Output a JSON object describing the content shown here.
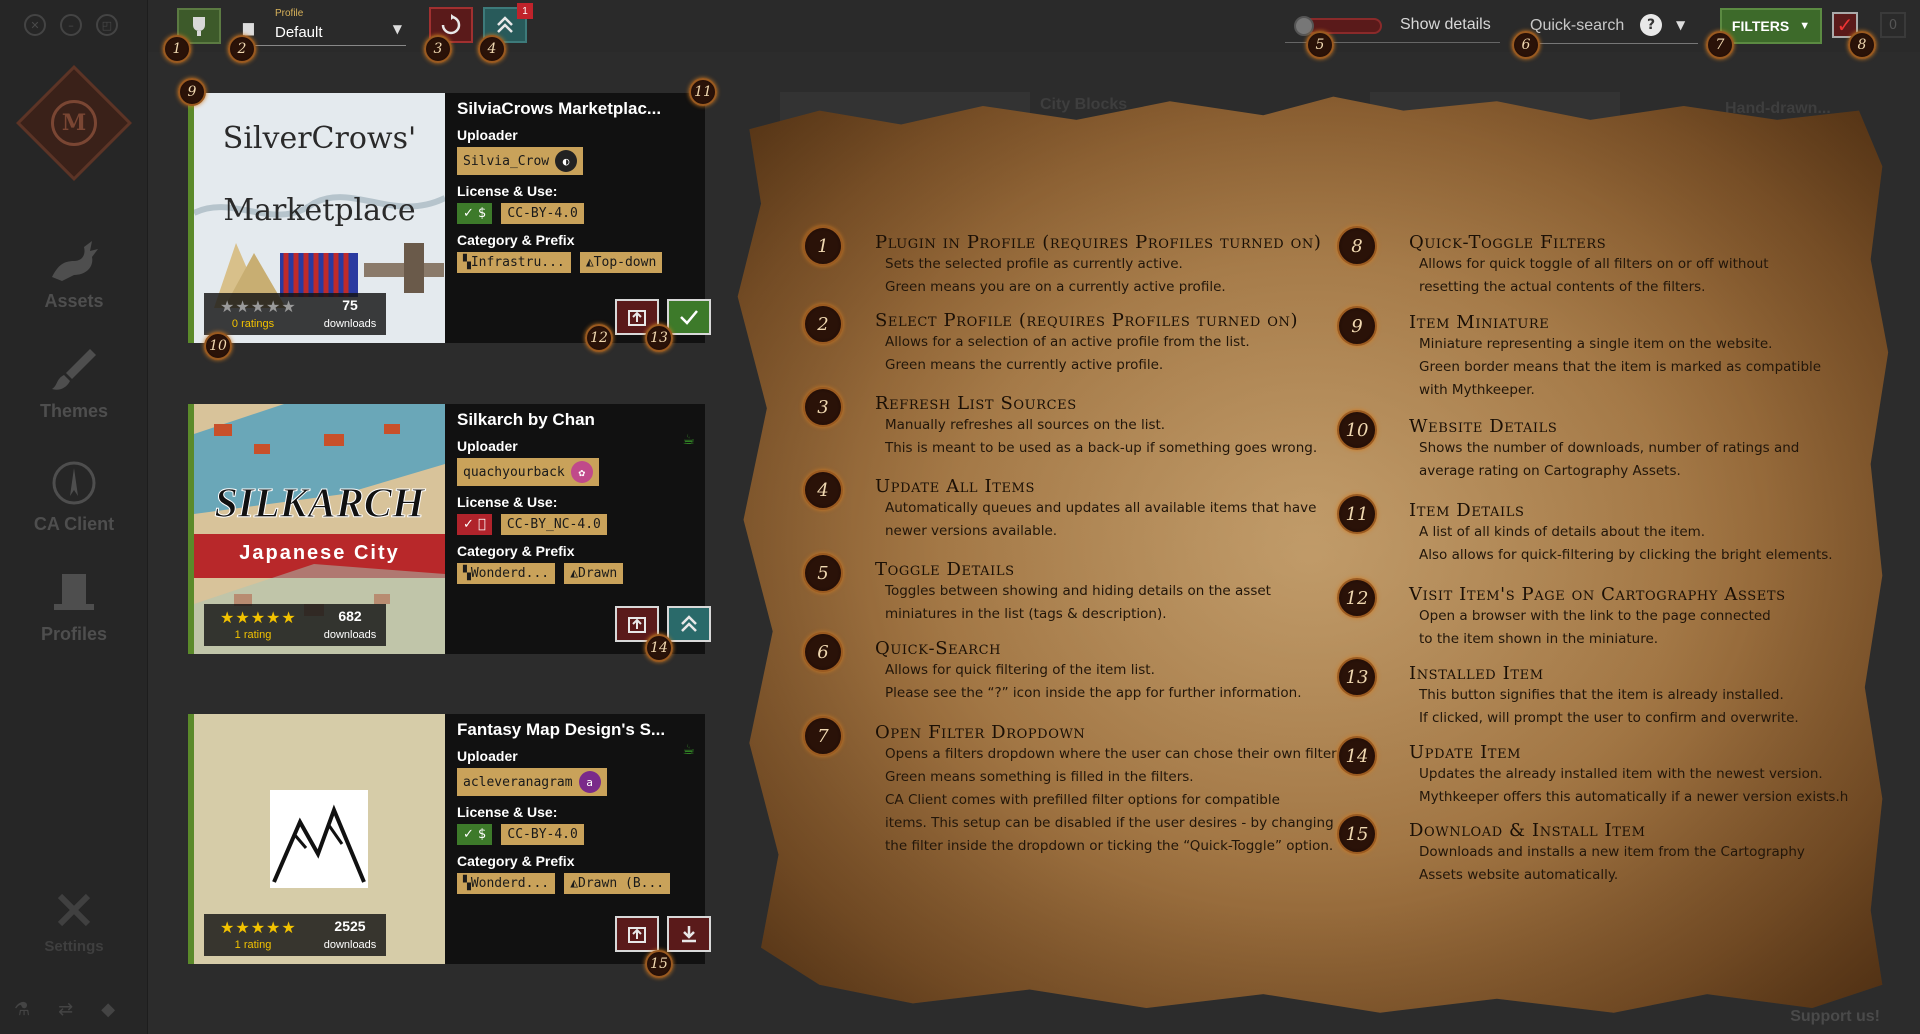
{
  "sidebar": {
    "nav": [
      {
        "label": "Assets",
        "icon": "dragon-icon"
      },
      {
        "label": "Themes",
        "icon": "brush-icon"
      },
      {
        "label": "CA Client",
        "icon": "compass-icon"
      },
      {
        "label": "Profiles",
        "icon": "top-hat-icon"
      },
      {
        "label": "Settings",
        "icon": "tools-icon"
      }
    ]
  },
  "topbar": {
    "profile_label": "Profile",
    "profile_value": "Default",
    "update_badge": "1",
    "show_details": "Show details",
    "quick_search_placeholder": "Quick-search",
    "help": "?",
    "filters": "FILTERS",
    "ghost_count": "0"
  },
  "cards": [
    {
      "title": "SilviaCrows Marketplac...",
      "uploader_label": "Uploader",
      "uploader": "Silvia_Crow",
      "license_label": "License & Use:",
      "license": "CC-BY-4.0",
      "license_ok": "✓ $",
      "category_label": "Category & Prefix",
      "category": "Infrastru...",
      "prefix": "Top-down",
      "stars": "★★★★★",
      "ratings": "0 ratings",
      "downloads": "75",
      "downloads_label": "downloads",
      "thumb_text1": "SilverCrows'",
      "thumb_text2": "Marketplace"
    },
    {
      "title": "Silkarch by Chan",
      "uploader_label": "Uploader",
      "uploader": "quachyourback",
      "license_label": "License & Use:",
      "license": "CC-BY_NC-4.0",
      "license_ok": "✓ ⃠",
      "category_label": "Category & Prefix",
      "category": "Wonderd...",
      "prefix": "Drawn",
      "stars": "★★★★★",
      "ratings": "1 rating",
      "downloads": "682",
      "downloads_label": "downloads",
      "thumb_text1": "SILKARCH",
      "thumb_text2": "Japanese City"
    },
    {
      "title": "Fantasy Map Design's S...",
      "uploader_label": "Uploader",
      "uploader": "acleveranagram",
      "uploader_avatar": "a",
      "license_label": "License & Use:",
      "license": "CC-BY-4.0",
      "license_ok": "✓ $",
      "category_label": "Category & Prefix",
      "category": "Wonderd...",
      "prefix": "Drawn (B...",
      "stars": "★★★★★",
      "ratings": "1 rating",
      "downloads": "2525",
      "downloads_label": "downloads"
    }
  ],
  "background_labels": [
    "City Blocks",
    "Hand-drawn..."
  ],
  "legend": [
    {
      "n": "1",
      "title": "Plugin in Profile (requires Profiles turned on)",
      "desc": [
        "Sets the selected profile as currently active.",
        "Green means you are on a currently active profile."
      ]
    },
    {
      "n": "2",
      "title": "Select Profile (requires Profiles turned on)",
      "desc": [
        "Allows for a selection of an active profile from the list.",
        "Green means the currently active profile."
      ]
    },
    {
      "n": "3",
      "title": "Refresh List Sources",
      "desc": [
        "Manually refreshes all sources on the list.",
        "This is meant to be used as a back-up if something goes wrong."
      ]
    },
    {
      "n": "4",
      "title": "Update All Items",
      "desc": [
        "Automatically queues and updates all available items that have",
        "newer versions available."
      ]
    },
    {
      "n": "5",
      "title": "Toggle Details",
      "desc": [
        "Toggles between showing and hiding details on the asset",
        "miniatures in the list (tags & description)."
      ]
    },
    {
      "n": "6",
      "title": "Quick-Search",
      "desc": [
        "Allows for quick filtering of the item list.",
        "Please see the “?” icon inside the app for further information."
      ]
    },
    {
      "n": "7",
      "title": "Open Filter Dropdown",
      "desc": [
        "Opens a filters dropdown where the user can chose their own filters.",
        "Green means something is filled in the filters.",
        "CA Client comes with prefilled filter options for compatible",
        "items. This setup can be disabled if the user desires - by changing",
        "the filter inside the dropdown or ticking the “Quick-Toggle” option."
      ]
    },
    {
      "n": "8",
      "title": "Quick-Toggle Filters",
      "desc": [
        "Allows for quick toggle of all filters on or off without",
        "resetting the actual contents of the filters."
      ]
    },
    {
      "n": "9",
      "title": "Item Miniature",
      "desc": [
        "Miniature representing a single item on the website.",
        "Green border means that the item is marked as compatible",
        "with Mythkeeper."
      ]
    },
    {
      "n": "10",
      "title": "Website Details",
      "desc": [
        "Shows the number of downloads, number of ratings and",
        "average rating on Cartography Assets."
      ]
    },
    {
      "n": "11",
      "title": "Item Details",
      "desc": [
        "A list of all kinds of details about the item.",
        "Also allows for quick-filtering by clicking the bright elements."
      ]
    },
    {
      "n": "12",
      "title": "Visit Item's Page on Cartography Assets",
      "desc": [
        "Open a browser with the link to the page connected",
        "to the item shown in the miniature."
      ]
    },
    {
      "n": "13",
      "title": "Installed Item",
      "desc": [
        "This button signifies that the item is already installed.",
        "If clicked, will prompt the user to confirm and overwrite."
      ]
    },
    {
      "n": "14",
      "title": "Update Item",
      "desc": [
        "Updates the already installed item with the newest version.",
        "Mythkeeper offers this automatically if a newer version exists.h"
      ]
    },
    {
      "n": "15",
      "title": "Download & Install Item",
      "desc": [
        "Downloads and installs a new item from the Cartography",
        "Assets website automatically."
      ]
    }
  ],
  "markers": [
    "1",
    "2",
    "3",
    "4",
    "5",
    "6",
    "7",
    "8",
    "9",
    "10",
    "11",
    "12",
    "13",
    "14",
    "15"
  ],
  "support": "Support us!"
}
